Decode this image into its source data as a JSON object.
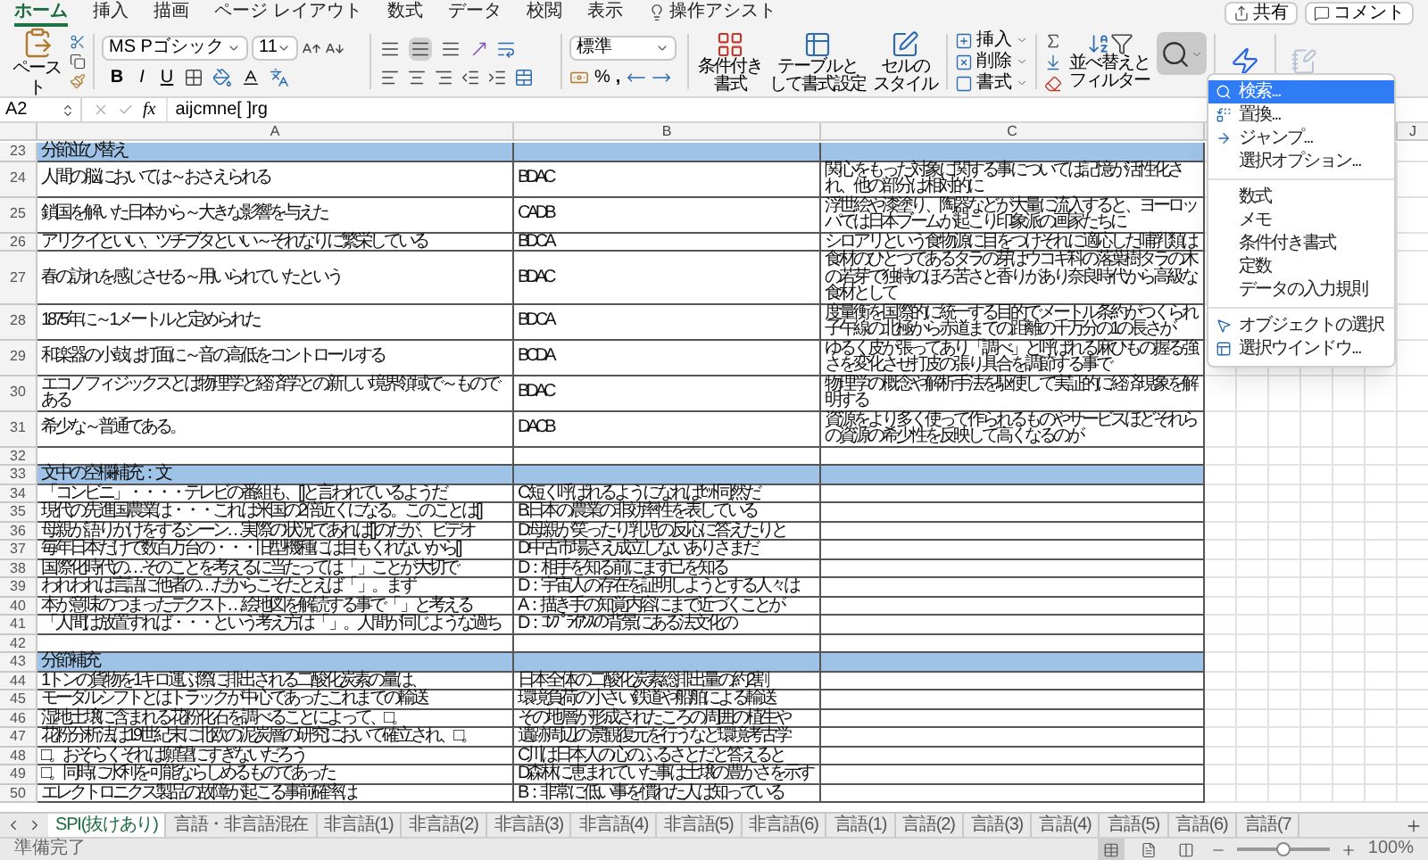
{
  "menu_tabs": [
    {
      "label": "ホーム",
      "selected": true
    },
    {
      "label": "挿入",
      "selected": false
    },
    {
      "label": "描画",
      "selected": false
    },
    {
      "label": "ページ レイアウト",
      "selected": false
    },
    {
      "label": "数式",
      "selected": false
    },
    {
      "label": "データ",
      "selected": false
    },
    {
      "label": "校閲",
      "selected": false
    },
    {
      "label": "表示",
      "selected": false
    }
  ],
  "assist": "操作アシスト",
  "share_button": "共有",
  "comment_button": "コメント",
  "ribbon": {
    "paste": "ペースト",
    "font_name": "MS Pゴシック",
    "font_size": "11",
    "format_buttons": [
      "B",
      "I",
      "U"
    ],
    "vertical_align": [
      {
        "selected": false
      },
      {
        "selected": true
      },
      {
        "selected": false
      }
    ],
    "number_format": "標準",
    "percent": "%",
    "comma": ",",
    "styles": [
      [
        "条件付き",
        "書式"
      ],
      [
        "テーブルと",
        "して書式設定"
      ],
      [
        "セルの",
        "スタイル"
      ]
    ],
    "cells": [
      "挿入",
      "削除",
      "書式"
    ],
    "sort_filter": [
      "並べ替えと",
      "フィルター"
    ],
    "find_selected": true
  },
  "formula_bar": {
    "name_box": "A2",
    "fx": "fx",
    "formula": "aijcmne[ ]rg"
  },
  "columns": [
    "A",
    "B",
    "C",
    "J"
  ],
  "rows": [
    {
      "num": "23",
      "kind": "section",
      "a": "分節並び替え"
    },
    {
      "num": "24",
      "kind": "data",
      "a": "人間の脳においては～おさえられる",
      "b": "BDAC",
      "c": "関心をもった対象に関する事については記憶が活性化され、他の部分は相対的に"
    },
    {
      "num": "25",
      "kind": "data",
      "a": "鎖国を解いた日本から～大きな影響を与えた",
      "b": "CADB",
      "c": "浮世絵や漆塗り、陶器などが大量に流入すると、ヨーロッパでは日本ブームが起こり印象派の画家たちに"
    },
    {
      "num": "26",
      "kind": "data",
      "a": "アリクイといい、ツチブタといい～それなりに繁栄している",
      "b": "BDCA",
      "c": "シロアリという食物源に目をつけそれに適応した哺乳類は"
    },
    {
      "num": "27",
      "kind": "data",
      "a": "春の訪れを感じさせる～用いられていたという",
      "b": "BDAC",
      "c": "食材のひとつであるタラの芽はウコギ科の落葉樹タラの木の若芽で独特のほろ苦さと香りがあり奈良時代から高級な食材として"
    },
    {
      "num": "28",
      "kind": "data",
      "a": "1875年に～1メートルと定められた",
      "b": "BDCA",
      "c": "度量衡を国際的に統一する目的でメートル条約がつくられ子午線の北極から赤道までの距離の千万分の1の長さが"
    },
    {
      "num": "29",
      "kind": "data",
      "a": "和楽器の小鼓は打面に～音の高低をコントロールする",
      "b": "BCDA",
      "c": "ゆるく皮が張ってあり「調べ」と呼ばれる麻ひもの握る強さを変化させ打皮の張り具合を調節する事で"
    },
    {
      "num": "30",
      "kind": "data",
      "a": "エコノフィジックスとは物理学と経済学との新しい境界領域で～ものである",
      "b": "BDAC",
      "c": "物理学の概念や解析手法を駆使して実証的に経済現象を解明する"
    },
    {
      "num": "31",
      "kind": "data",
      "a": "希少な～普通である。",
      "b": "DACB",
      "c": "資源をより多く使って作られるものやサービスほどそれらの資源の希少性を反映して高くなるのが"
    },
    {
      "num": "32",
      "kind": "blank"
    },
    {
      "num": "33",
      "kind": "section",
      "a": "文中の空欄補充：文"
    },
    {
      "num": "34",
      "kind": "data",
      "a": "「コンビニ」・・・・テレビの番組も、[ ]と言われているようだ",
      "b": "C:短く呼ばれるようになればﾋｯﾄ同然だ"
    },
    {
      "num": "35",
      "kind": "data",
      "a": "現代の先進国農業は・・・これは米国の2倍近くになる。このことは[ ]",
      "b": "B:日本の農業の非効率性を表している"
    },
    {
      "num": "36",
      "kind": "data",
      "a": "母親が語りかけをするシーン…実際の状況であれば[ ]のだが、ビデオ",
      "b": "D:母親が笑ったり乳児の反応に答えたりと"
    },
    {
      "num": "37",
      "kind": "data",
      "a": "毎年日本だけで数百万台の・・・旧型機種には目もくれないから[ ]",
      "b": "D:中古市場さえ成立しないありさまだ"
    },
    {
      "num": "38",
      "kind": "data",
      "a": "国際化時代の…そのことを考えるに当たっては「 」ことが大切で",
      "b": "D：相手を知る前にまず己を知る"
    },
    {
      "num": "39",
      "kind": "data",
      "a": "われわれは言語に他者の…だからこそたとえば「 」。まず",
      "b": "D：宇宙人の存在を証明しようとする人々は"
    },
    {
      "num": "40",
      "kind": "data",
      "a": "本が意味のつまったテクスト…絵地図を解読する事で「 」と考える",
      "b": "A：描き手の知覚内容にまで近づくことが"
    },
    {
      "num": "41",
      "kind": "data",
      "a": "「人間は放置すれば・・・という考え方は「 」。人間が同じような過ち",
      "b": "D：ｺﾝﾌﾟﾗｲｱﾝｽの背景にある法文化の"
    },
    {
      "num": "42",
      "kind": "blank"
    },
    {
      "num": "43",
      "kind": "section",
      "a": "分節補充"
    },
    {
      "num": "44",
      "kind": "data",
      "a": "1トンの貨物を1キロ運ぶ際に排出される二酸化炭素の量は、",
      "b": "日本全体の二酸化炭素総排出量の約2割"
    },
    {
      "num": "45",
      "kind": "data",
      "a": "モーダルシフトとはトラックが中心であったこれまでの輸送",
      "b": "環境負荷の小さい鉄道や船舶による輸送"
    },
    {
      "num": "46",
      "kind": "data",
      "a": "湿地土壌に含まれる花粉化石を調べることによって、□。",
      "b": "その地層が形成されたころの周囲の植生や"
    },
    {
      "num": "47",
      "kind": "data",
      "a": "花粉分析法は19世紀末に北欧の泥炭層の研究において確立され、□。",
      "b": "遺跡周辺の景観復元を行うなど環境考古学"
    },
    {
      "num": "48",
      "kind": "data",
      "a": "□。おそらくそれは願望にすぎないだろう",
      "b": "C川は日本人の心のふるさとだと答えると"
    },
    {
      "num": "49",
      "kind": "data",
      "a": "□。同時に水利を可能ならしめるものであった",
      "b": "D森林に恵まれていた事は土壌の豊かさを示す"
    },
    {
      "num": "50",
      "kind": "data",
      "a": "エレクトロニクス製品の故障が起こる事前確率は",
      "b": "B：非常に低い事を慣れた人は知っている"
    }
  ],
  "find_menu": [
    [
      {
        "label": "検索...",
        "selected": true
      },
      {
        "label": "置換...",
        "selected": false
      },
      {
        "label": "ジャンプ...",
        "selected": false
      },
      {
        "label": "選択オプション...",
        "selected": false
      }
    ],
    [
      {
        "label": "数式",
        "selected": false
      },
      {
        "label": "メモ",
        "selected": false
      },
      {
        "label": "条件付き書式",
        "selected": false
      },
      {
        "label": "定数",
        "selected": false
      },
      {
        "label": "データの入力規則",
        "selected": false
      }
    ],
    [
      {
        "label": "オブジェクトの選択",
        "selected": false
      },
      {
        "label": "選択ウインドウ...",
        "selected": false
      }
    ]
  ],
  "sheet_tabs": [
    {
      "label": "SPI(抜けあり)",
      "selected": true
    },
    {
      "label": "言語・非言語混在",
      "selected": false
    },
    {
      "label": "非言語(1)",
      "selected": false
    },
    {
      "label": "非言語(2)",
      "selected": false
    },
    {
      "label": "非言語(3)",
      "selected": false
    },
    {
      "label": "非言語(4)",
      "selected": false
    },
    {
      "label": "非言語(5)",
      "selected": false
    },
    {
      "label": "非言語(6)",
      "selected": false
    },
    {
      "label": "言語(1)",
      "selected": false
    },
    {
      "label": "言語(2)",
      "selected": false
    },
    {
      "label": "言語(3)",
      "selected": false
    },
    {
      "label": "言語(4)",
      "selected": false
    },
    {
      "label": "言語(5)",
      "selected": false
    },
    {
      "label": "言語(6)",
      "selected": false
    },
    {
      "label": "言語(7",
      "selected": false
    }
  ],
  "status": {
    "text": "準備完了",
    "views": [
      {
        "selected": true
      },
      {
        "selected": false
      },
      {
        "selected": false
      }
    ],
    "zoom": {
      "level": 0.5,
      "reading": "100%"
    }
  }
}
